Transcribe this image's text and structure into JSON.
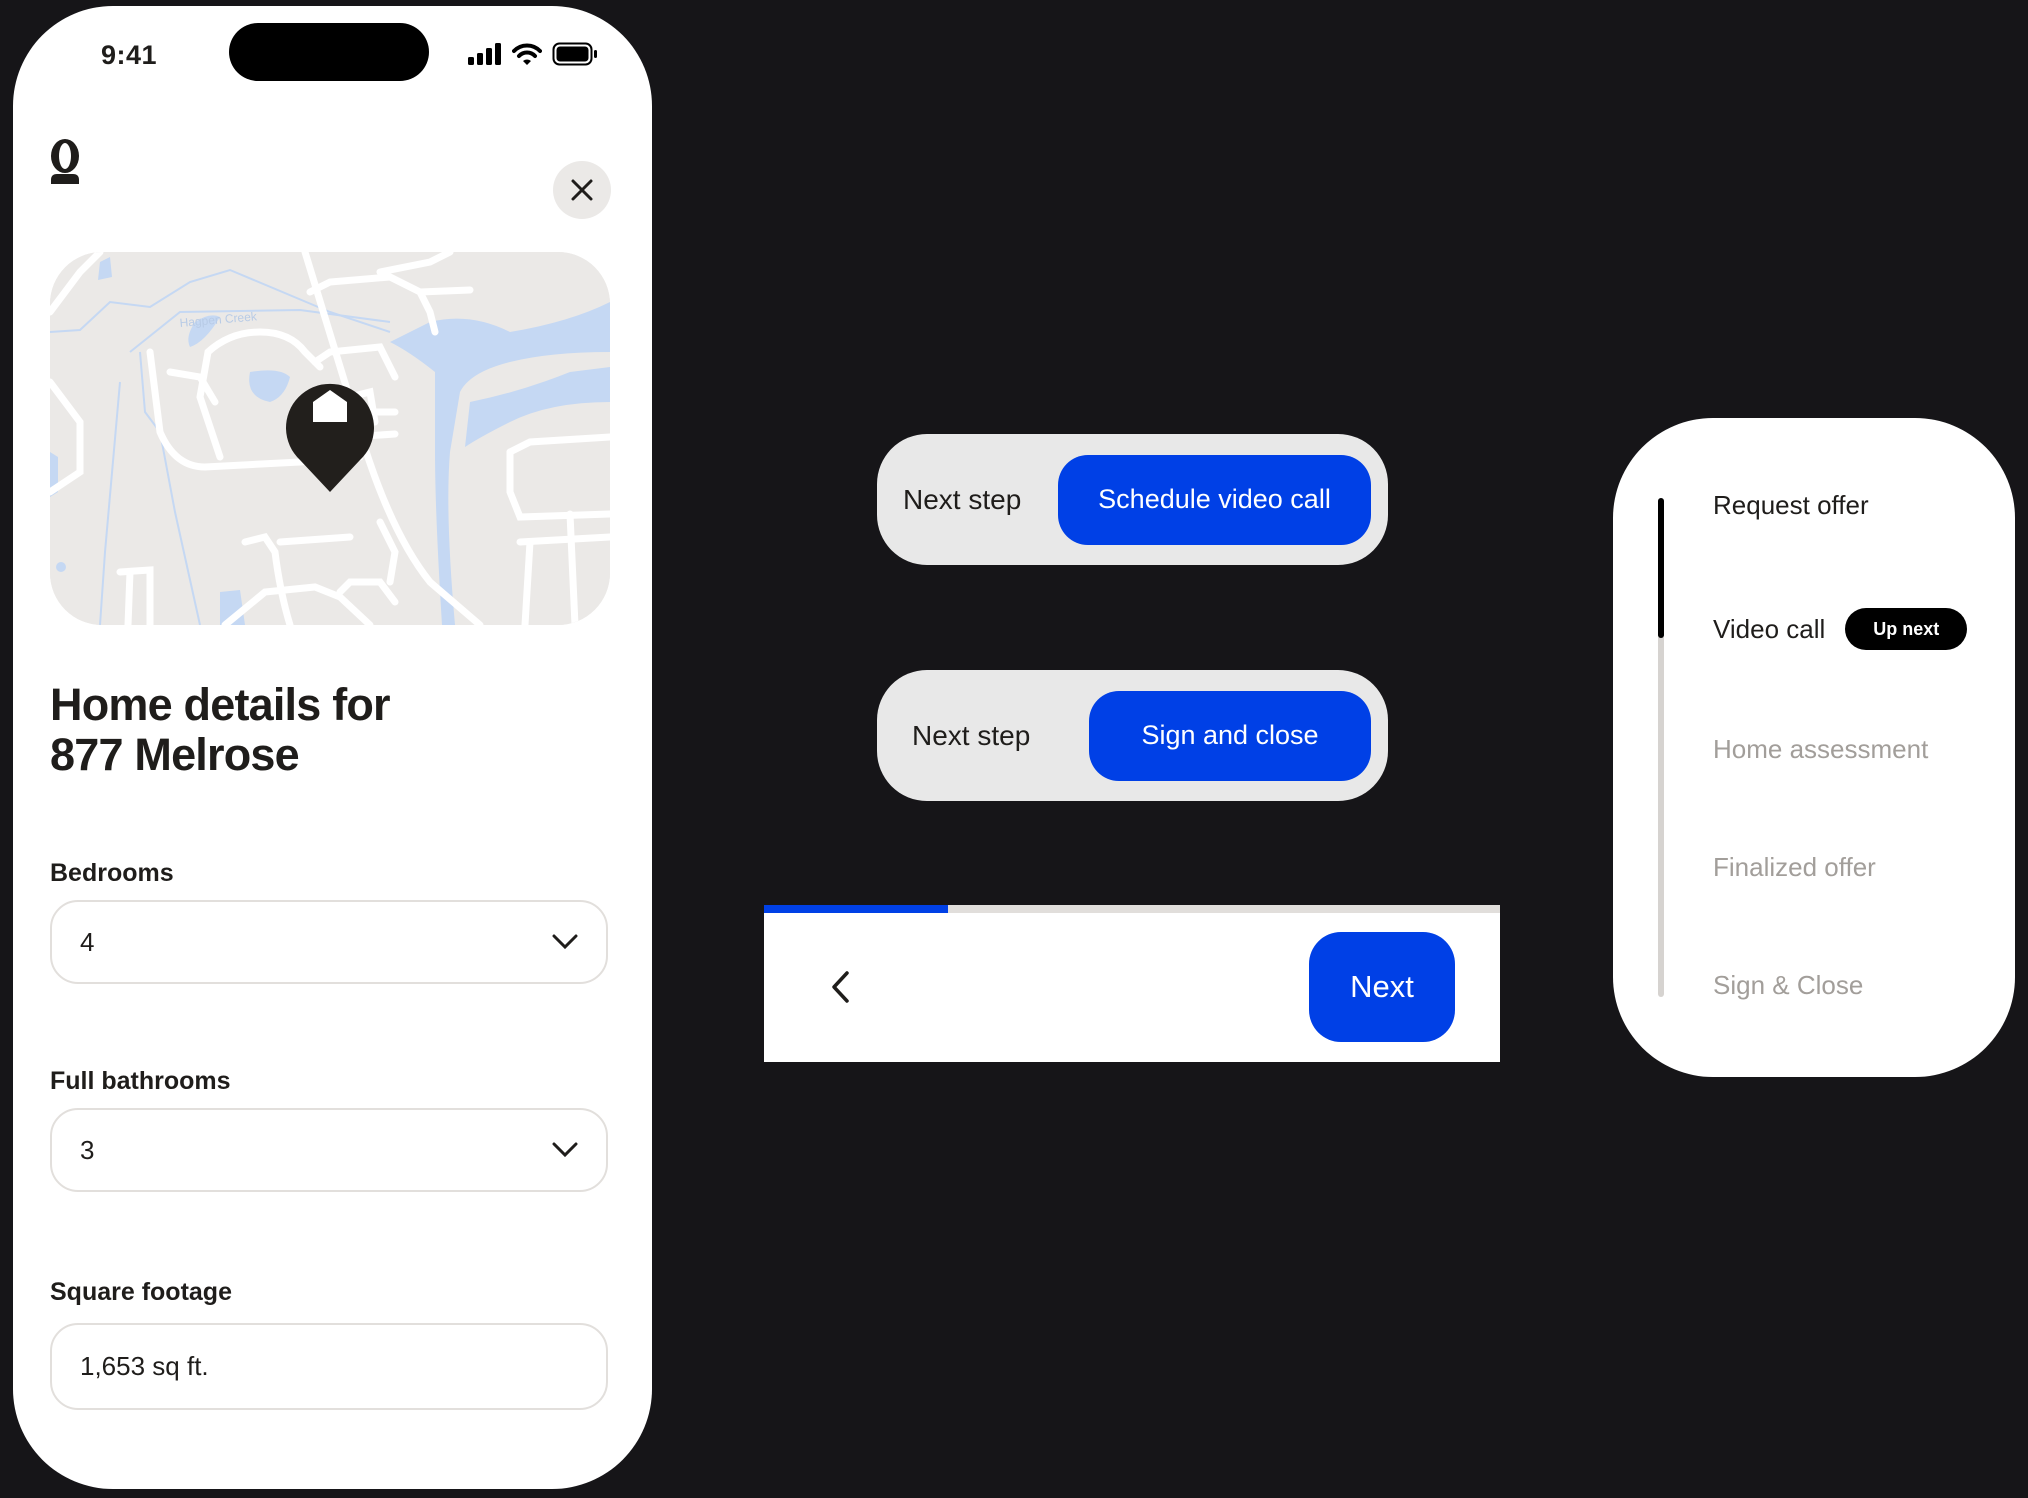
{
  "colors": {
    "background": "#161518",
    "accent": "#0040e6",
    "pill": "#e8e8e8",
    "muted_text": "#a29e9a",
    "map_water": "#c5d8f3",
    "map_land": "#ebe9e7"
  },
  "phone": {
    "status_bar": {
      "time": "9:41",
      "icons": [
        "signal-icon",
        "wifi-icon",
        "battery-icon"
      ]
    },
    "logo_text": "o",
    "close_icon": "close-icon",
    "map": {
      "label": "Hagpen Creek",
      "pin_icon": "home-pin-icon"
    },
    "title_line1": "Home details for",
    "title_line2": "877 Melrose",
    "fields": [
      {
        "label": "Bedrooms",
        "value": "4",
        "type": "select"
      },
      {
        "label": "Full bathrooms",
        "value": "3",
        "type": "select"
      },
      {
        "label": "Square footage",
        "value": "1,653 sq ft.",
        "type": "text"
      }
    ]
  },
  "next_step_pills": [
    {
      "label": "Next step",
      "button": "Schedule video call"
    },
    {
      "label": "Next step",
      "button": "Sign and close"
    }
  ],
  "nav_bar": {
    "progress": 0.25,
    "back_icon": "chevron-left-icon",
    "next_label": "Next"
  },
  "timeline": {
    "progress": 0.28,
    "steps": [
      {
        "label": "Request offer",
        "state": "done"
      },
      {
        "label": "Video call",
        "state": "current",
        "badge": "Up next"
      },
      {
        "label": "Home assessment",
        "state": "todo"
      },
      {
        "label": "Finalized offer",
        "state": "todo"
      },
      {
        "label": "Sign & Close",
        "state": "todo"
      }
    ]
  }
}
